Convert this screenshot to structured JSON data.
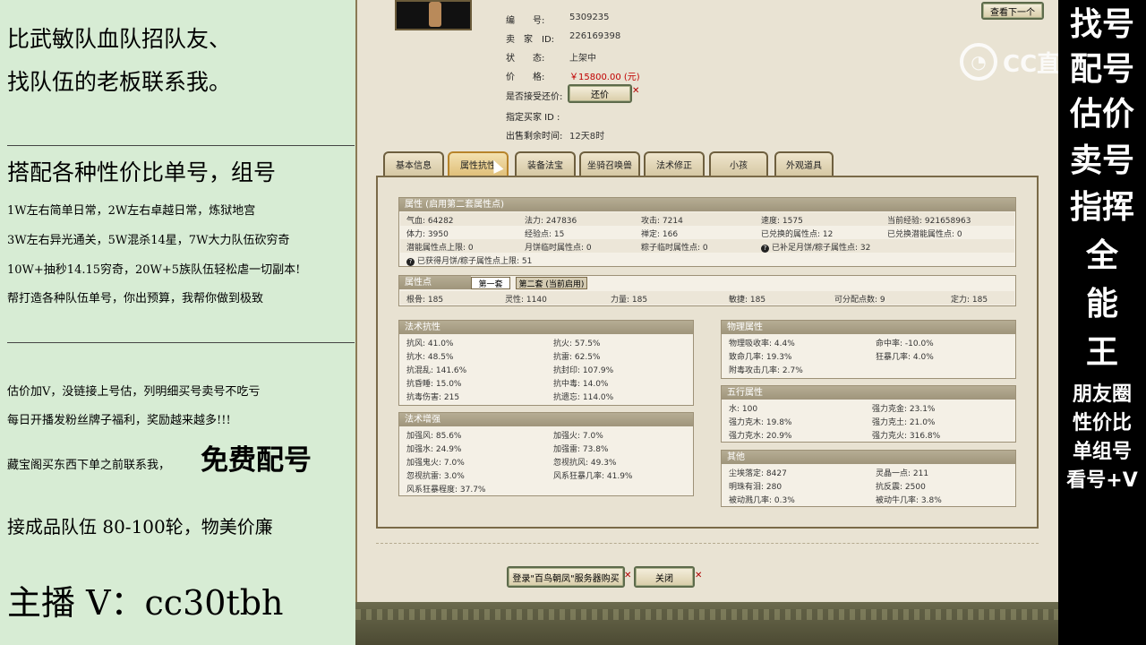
{
  "left_promo": {
    "line1": "比武敏队血队招队友、",
    "line2": "找队伍的老板联系我。",
    "line3": "搭配各种性价比单号，组号",
    "line4": "1W左右简单日常，2W左右卓越日常，炼狱地宫",
    "line5": "3W左右异光通关，5W混杀14星，7W大力队伍砍穷奇",
    "line6": "10W+抽秒14.15穷奇，20W+5族队伍轻松虐一切副本!",
    "line7": "帮打造各种队伍单号，你出预算，我帮你做到极致",
    "line8": "估价加V，没链接上号估，列明细买号卖号不吃亏",
    "line9": "每日开播发粉丝牌子福利，奖励越来越多!!!",
    "line10a": "藏宝阁买东西下单之前联系我，",
    "line10b": "免费配号",
    "line11": "接成品队伍 80-100轮，物美价廉",
    "line12": "主播 V：cc30tbh"
  },
  "right_promo": {
    "chars": [
      "找号",
      "配号",
      "估价",
      "卖号",
      "指挥",
      "全",
      "能",
      "王"
    ],
    "small1": "朋友圈",
    "small2": "性价比",
    "small3": "单组号",
    "small4": "看号+V"
  },
  "logo": {
    "text": "CC直播"
  },
  "listing": {
    "id_label": "编　　号:",
    "id_value": "5309235",
    "seller_label": "卖　家　ID:",
    "seller_value": "226169398",
    "status_label": "状　　态:",
    "status_value": "上架中",
    "price_label": "价　　格:",
    "price_value": "￥15800.00 (元)",
    "bargain_label": "是否接受还价:",
    "bargain_button": "还价",
    "buyer_label": "指定买家 ID :",
    "time_label": "出售剩余时间:",
    "time_value": "12天8时",
    "next_button": "查看下一个"
  },
  "tabs": [
    "基本信息",
    "属性抗性",
    "装备法宝",
    "坐骑召唤兽",
    "法术修正",
    "小孩",
    "外观道具"
  ],
  "attr_box": {
    "title": "属性 (启用第二套属性点)",
    "rows": [
      [
        "气血: 64282",
        "法力: 247836",
        "攻击: 7214",
        "速度: 1575",
        "当前经验: 921658963"
      ],
      [
        "体力: 3950",
        "经验点: 15",
        "禅定: 166",
        "已兑换的属性点: 12",
        "已兑换潜能属性点: 0"
      ],
      [
        "潜能属性点上限: 0",
        "月饼临时属性点: 0",
        "粽子临时属性点: 0",
        "已补足月饼/粽子属性点: 32",
        ""
      ],
      [
        "已获得月饼/粽子属性点上限: 51",
        "",
        "",
        "",
        ""
      ]
    ]
  },
  "points_box": {
    "title": "属性点",
    "subtab1": "第一套",
    "subtab2": "第二套 (当前启用)",
    "cells": [
      "根骨: 185",
      "灵性: 1140",
      "力量: 185",
      "敏捷: 185",
      "可分配点数: 9",
      "定力: 185"
    ]
  },
  "resist_box": {
    "title": "法术抗性",
    "rows": [
      [
        "抗风: 41.0%",
        "抗火: 57.5%"
      ],
      [
        "抗水: 48.5%",
        "抗雷: 62.5%"
      ],
      [
        "抗混乱: 141.6%",
        "抗封印: 107.9%"
      ],
      [
        "抗昏睡: 15.0%",
        "抗中毒: 14.0%"
      ],
      [
        "抗毒伤害: 215",
        "抗遗忘: 114.0%"
      ]
    ]
  },
  "boost_box": {
    "title": "法术增强",
    "rows": [
      [
        "加强风: 85.6%",
        "加强火: 7.0%"
      ],
      [
        "加强水: 24.9%",
        "加强雷: 73.8%"
      ],
      [
        "加强鬼火: 7.0%",
        "忽视抗风: 49.3%"
      ],
      [
        "忽视抗雷: 3.0%",
        "风系狂暴几率: 41.9%"
      ],
      [
        "风系狂暴程度: 37.7%",
        ""
      ]
    ]
  },
  "phys_box": {
    "title": "物理属性",
    "rows": [
      [
        "物理吸收率: 4.4%",
        "命中率: -10.0%"
      ],
      [
        "致命几率: 19.3%",
        "狂暴几率: 4.0%"
      ],
      [
        "附毒攻击几率: 2.7%",
        ""
      ]
    ]
  },
  "five_box": {
    "title": "五行属性",
    "rows": [
      [
        "水: 100",
        "强力克金: 23.1%"
      ],
      [
        "强力克木: 19.8%",
        "强力克土: 21.0%"
      ],
      [
        "强力克水: 20.9%",
        "强力克火: 316.8%"
      ]
    ]
  },
  "other_box": {
    "title": "其他",
    "rows": [
      [
        "尘埃落定: 8427",
        "灵晶一点: 211"
      ],
      [
        "明珠有泪: 280",
        "抗反震: 2500"
      ],
      [
        "被动溅几率: 0.3%",
        "被动牛几率: 3.8%"
      ]
    ]
  },
  "footer": {
    "login_button": "登录\"百鸟朝凤\"服务器购买",
    "close_button": "关闭"
  }
}
